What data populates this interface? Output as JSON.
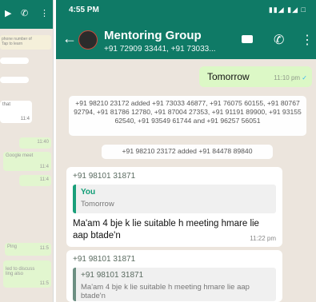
{
  "left_screen": {
    "bubble_1": "phone number of\nTap to learn",
    "bubble_2": "that",
    "bubble_2_time": "11:4",
    "bubble_3_time": "11:40",
    "bubble_4": "Google meet",
    "bubble_4_time": "11:4",
    "bubble_5_time": "11:4",
    "bubble_6": "Ping",
    "bubble_6_time": "11:5",
    "bubble_7": "led to discuss\nling also",
    "bubble_7_time": "11:5"
  },
  "status_bar": {
    "time": "4:55 PM",
    "right_icons": "▮▮◢ ▮◢ □"
  },
  "header": {
    "title": "Mentoring Group",
    "subtitle": "+91 72909 33441, +91 73033..."
  },
  "messages": {
    "outgoing": {
      "text": "Tomorrow",
      "time": "11:10 pm"
    },
    "system_1": "+91 98210 23172 added +91 73033 46877, +91 76075 60155, +91 80767 92794, +91 81786 12780, +91 87004 27353, +91 91191 89900, +91 93155 62540, +91 93549 61744 and +91 96257 56051",
    "system_2": "+91 98210 23172 added +91 84478 89840",
    "incoming_1": {
      "sender": "+91 98101 31871",
      "quote_name": "You",
      "quote_text": "Tomorrow",
      "text": "Ma'am 4 bje k lie suitable h meeting hmare lie aap btade'n",
      "time": "11:22 pm"
    },
    "incoming_2": {
      "sender": "+91 98101 31871",
      "quote_name": "+91 98101 31871",
      "quote_text": "Ma'am 4 bje k lie suitable h meeting hmare lie aap btade'n"
    }
  },
  "colors": {
    "header": "#0f7a66",
    "chat_bg": "#ece5dd",
    "outgoing": "#dcf8c6",
    "quote_accent": "#1a9f7a"
  }
}
